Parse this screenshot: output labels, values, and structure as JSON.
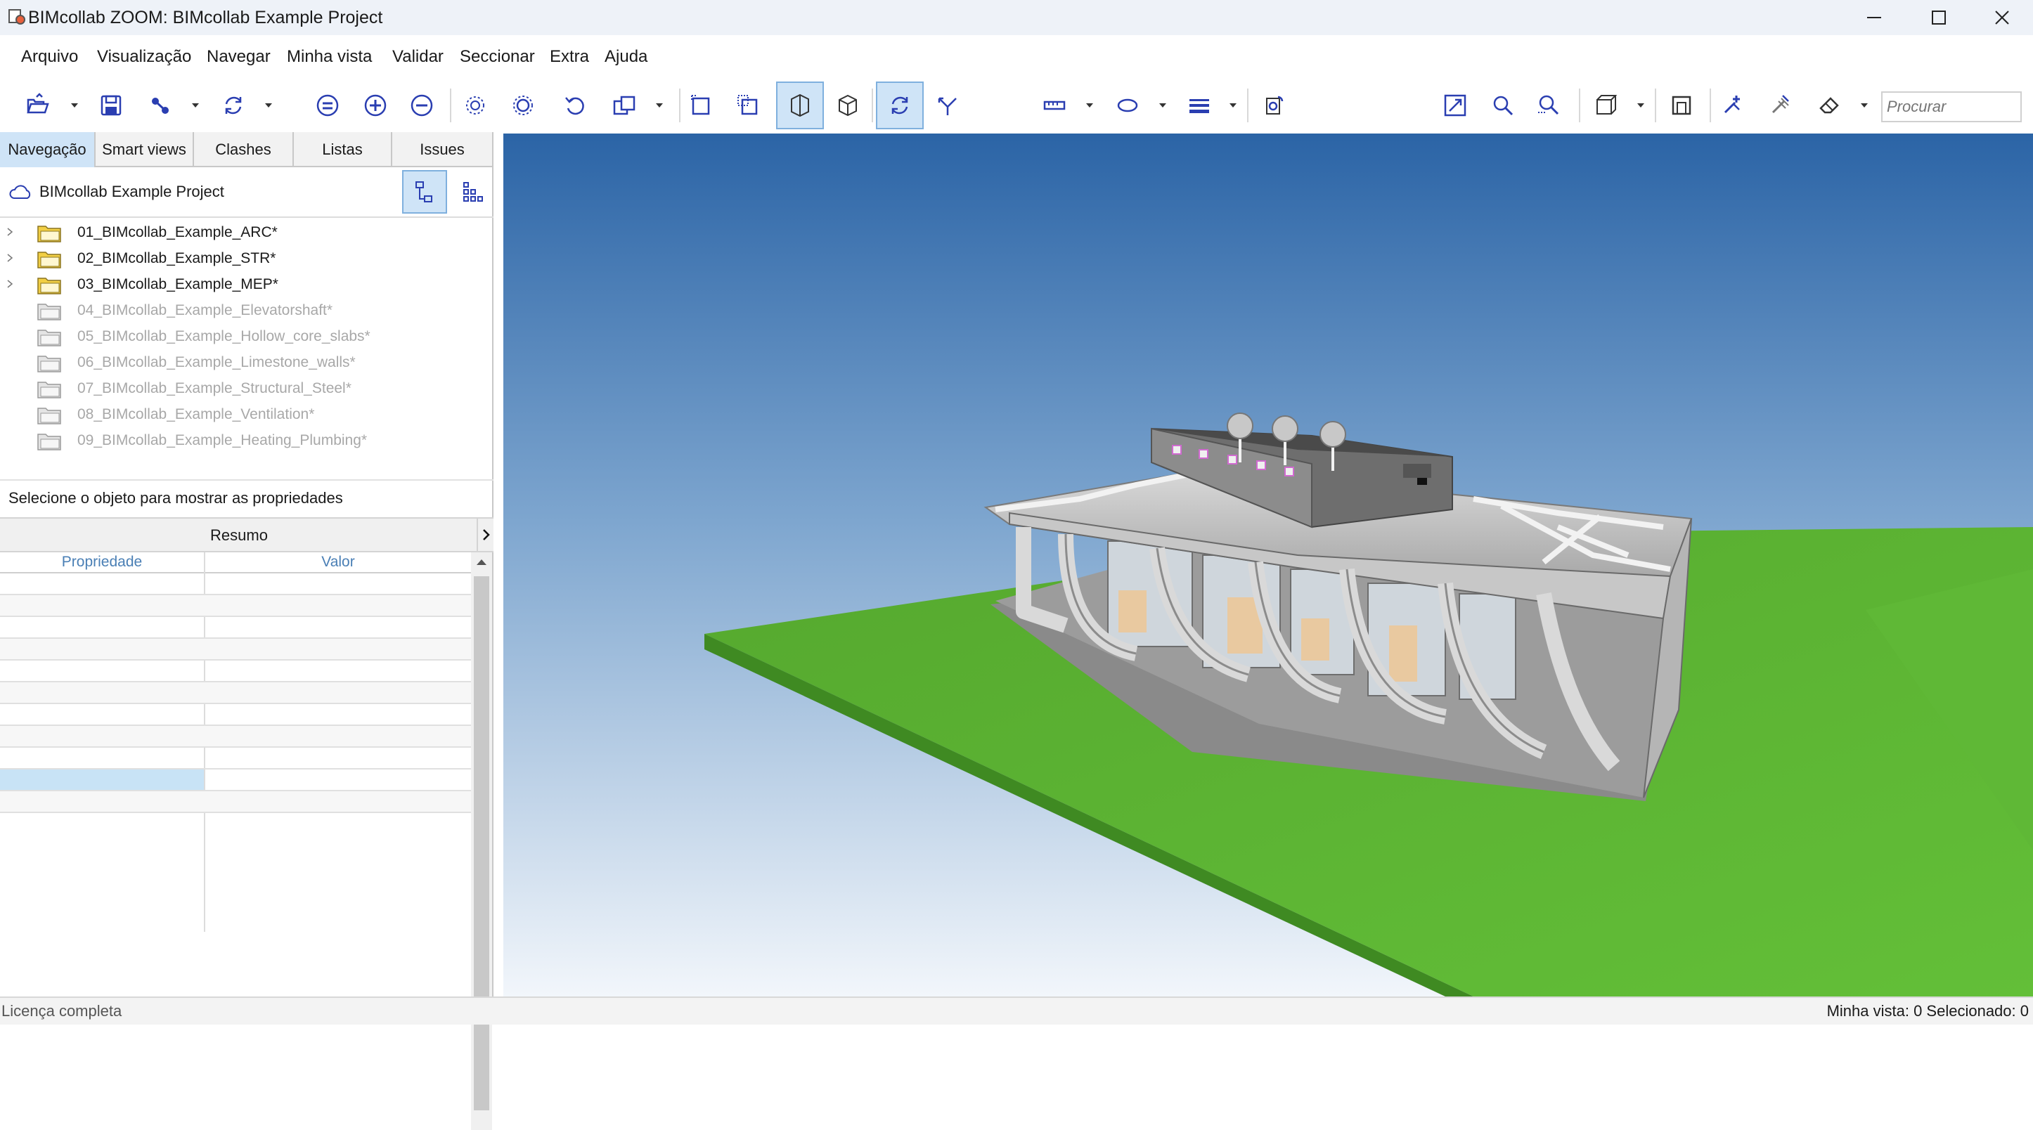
{
  "window": {
    "title": "BIMcollab ZOOM: BIMcollab Example Project"
  },
  "menu": [
    "Arquivo",
    "Visualização",
    "Navegar",
    "Minha vista",
    "Validar",
    "Seccionar",
    "Extra",
    "Ajuda"
  ],
  "toolbar": {
    "search_placeholder": "Procurar",
    "accent": "#2a3eb1",
    "active_bg": "#cfe4f7"
  },
  "tabs": [
    "Navegação",
    "Smart views",
    "Clashes",
    "Listas",
    "Issues"
  ],
  "active_tab": "Navegação",
  "project": {
    "name": "BIMcollab Example Project"
  },
  "models": [
    {
      "name": "01_BIMcollab_Example_ARC*",
      "loaded": true
    },
    {
      "name": "02_BIMcollab_Example_STR*",
      "loaded": true
    },
    {
      "name": "03_BIMcollab_Example_MEP*",
      "loaded": true
    },
    {
      "name": "04_BIMcollab_Example_Elevatorshaft*",
      "loaded": false
    },
    {
      "name": "05_BIMcollab_Example_Hollow_core_slabs*",
      "loaded": false
    },
    {
      "name": "06_BIMcollab_Example_Limestone_walls*",
      "loaded": false
    },
    {
      "name": "07_BIMcollab_Example_Structural_Steel*",
      "loaded": false
    },
    {
      "name": "08_BIMcollab_Example_Ventilation*",
      "loaded": false
    },
    {
      "name": "09_BIMcollab_Example_Heating_Plumbing*",
      "loaded": false
    }
  ],
  "properties": {
    "hint": "Selecione o objeto para mostrar as propriedades",
    "summary_label": "Resumo",
    "col_property": "Propriedade",
    "col_value": "Valor"
  },
  "status": {
    "license": "Licença completa",
    "right": "Minha vista: 0  Selecionado: 0"
  },
  "colors": {
    "sky_top": "#2b64a6",
    "sky_bottom": "#f2f6fb",
    "ground": "#5bb033",
    "ground_edge": "#3f8a22"
  }
}
